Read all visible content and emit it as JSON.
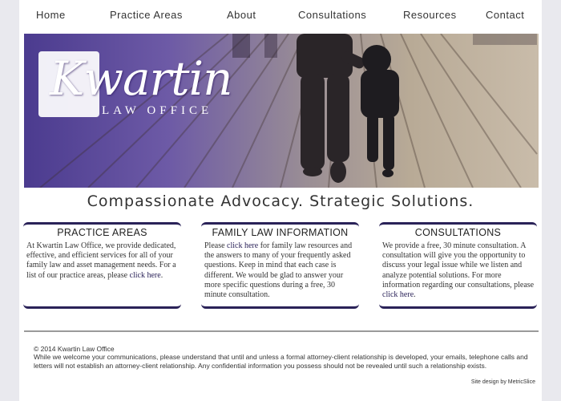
{
  "nav": {
    "items": [
      "Home",
      "Practice Areas",
      "About",
      "Consultations",
      "Resources",
      "Contact"
    ]
  },
  "hero": {
    "logo_word": "Kwartin",
    "logo_sub": "LAW OFFICE"
  },
  "tagline": "Compassionate Advocacy. Strategic Solutions.",
  "boxes": [
    {
      "title": "PRACTICE AREAS",
      "before": "At Kwartin Law Office, we provide dedicated, effective, and efficient services for all of your family law and asset management needs. For a list of our practice areas, please ",
      "link": "click here",
      "after": "."
    },
    {
      "title": "FAMILY LAW INFORMATION",
      "before": "Please ",
      "link": "click here",
      "after": " for family law resources and the answers to many of your frequently asked questions. Keep in mind that each case is different. We would be glad to answer your more specific questions during a free, 30 minute consultation."
    },
    {
      "title": "CONSULTATIONS",
      "before": "We provide a free, 30 minute consultation. A consultation will give you the opportunity to discuss your legal issue while we listen and analyze potential solutions. For more information regarding our consultations, please ",
      "link": "click here",
      "after": "."
    }
  ],
  "footer": {
    "copyright": "© 2014 Kwartin Law Office",
    "disclaimer": "While we welcome your communications, please understand that until and unless a formal attorney-client relationship is developed, your emails, telephone calls and letters will not establish an attorney-client relationship. Any confidential information you possess should not be revealed until such a relationship exists.",
    "credit_prefix": "Site design by ",
    "credit_link": "MetricSlice"
  },
  "colors": {
    "accent": "#2a2258",
    "logo_purple": "#5d3ea3"
  }
}
